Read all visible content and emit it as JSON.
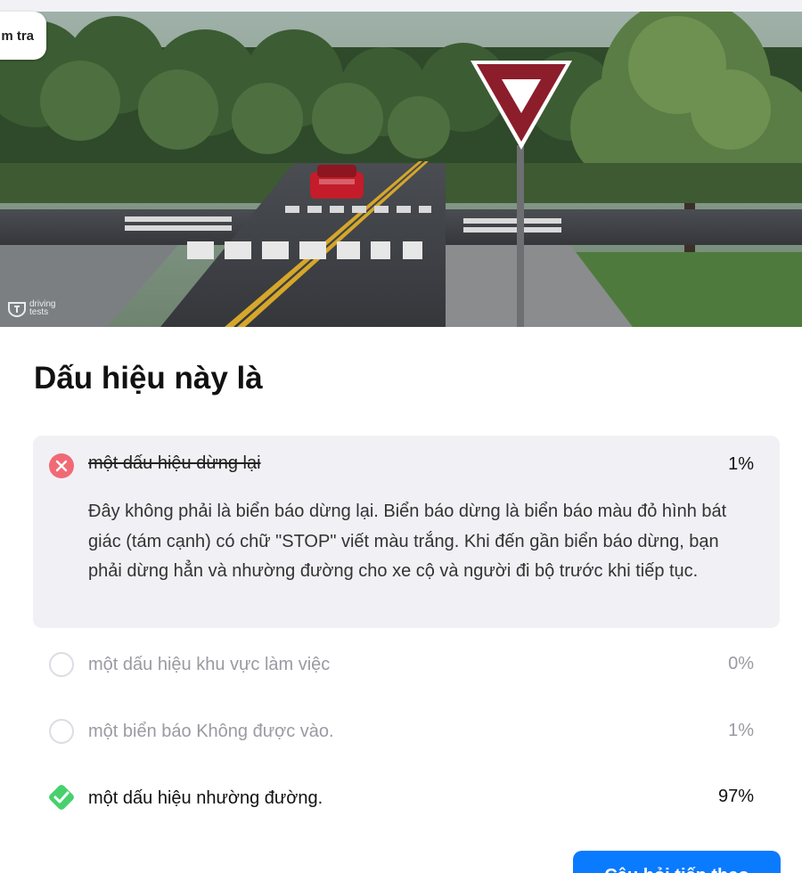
{
  "header": {
    "chip_label": "m tra",
    "watermark": "driving tests"
  },
  "question": {
    "title": "Dấu hiệu này là"
  },
  "answers": [
    {
      "text": "một dấu hiệu dừng lại",
      "percent": "1%",
      "state": "wrong-selected",
      "explanation": "Đây không phải là biển báo dừng lại. Biển báo dừng là biển báo màu đỏ hình bát giác (tám cạnh) có chữ \"STOP\" viết màu trắng. Khi đến gần biển báo dừng, bạn phải dừng hẳn và nhường đường cho xe cộ và người đi bộ trước khi tiếp tục."
    },
    {
      "text": "một dấu hiệu khu vực làm việc",
      "percent": "0%",
      "state": "unselected"
    },
    {
      "text": "một biển báo Không được vào.",
      "percent": "1%",
      "state": "unselected"
    },
    {
      "text": "một dấu hiệu nhường đường.",
      "percent": "97%",
      "state": "correct"
    }
  ],
  "next_button": {
    "label": "Câu hỏi tiếp theo"
  },
  "colors": {
    "wrong": "#f06a75",
    "correct": "#47d16c",
    "button": "#0a7aff",
    "wrong_bg": "#f1f1f5"
  },
  "icons": {
    "wrong": "x-circle-icon",
    "correct": "check-diamond-icon",
    "empty": "radio-empty-icon"
  }
}
